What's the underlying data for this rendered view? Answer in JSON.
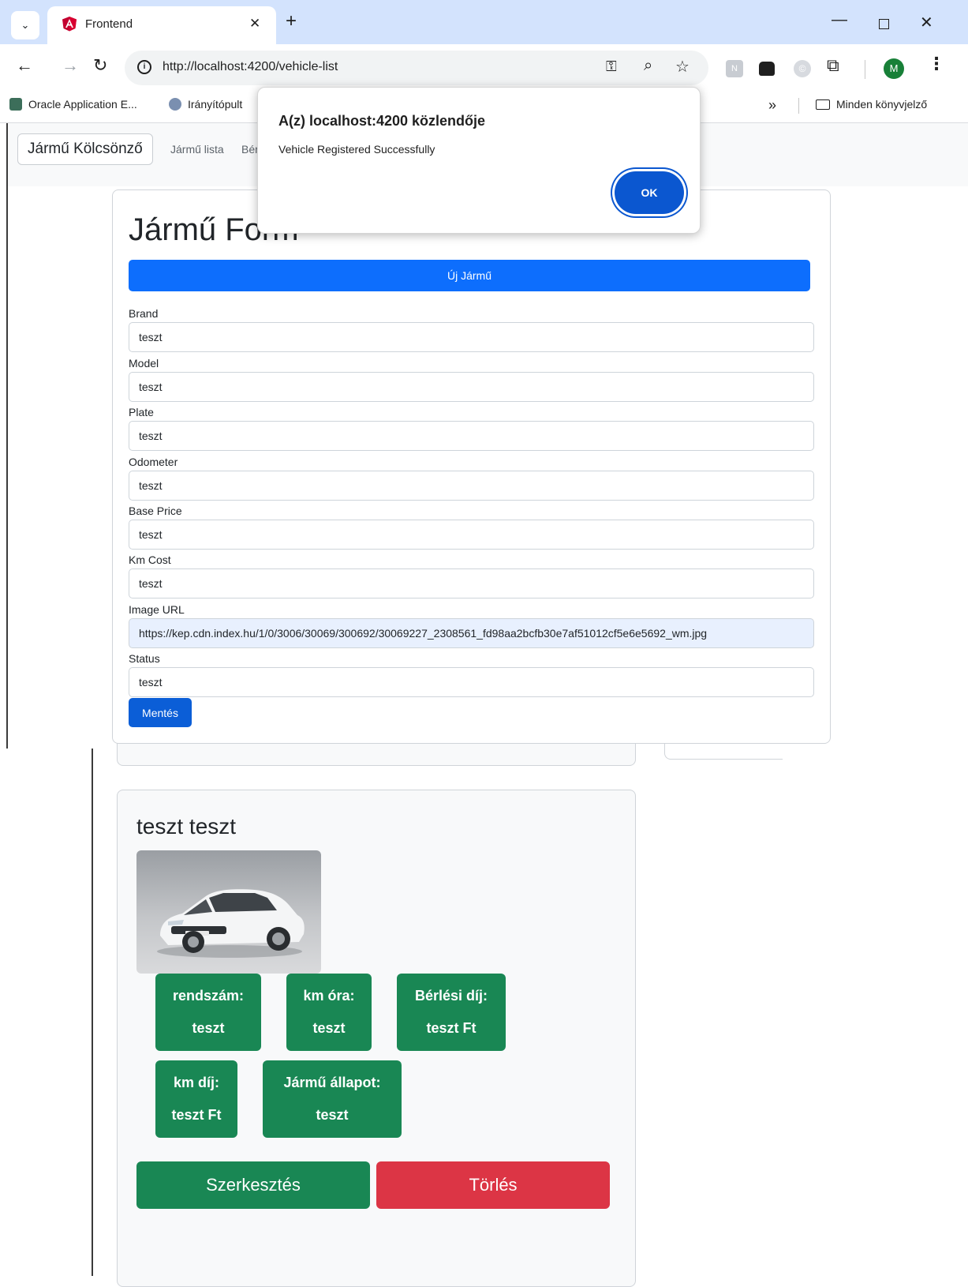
{
  "browser": {
    "tab_title": "Frontend",
    "tab_close": "✕",
    "new_tab": "+",
    "url": "http://localhost:4200/vehicle-list",
    "avatar_letter": "M",
    "bookmarks": [
      {
        "label": "Oracle Application E...",
        "color": "#3c6e5a"
      },
      {
        "label": "Irányítópult",
        "color": "#7a8fb0"
      }
    ],
    "bookmarks_overflow": "»",
    "all_bookmarks_label": "Minden könyvjelző"
  },
  "navbar": {
    "brand": "Jármű Kölcsönző",
    "links": [
      "Jármű lista",
      "Bér"
    ]
  },
  "form": {
    "title": "Jármű Form",
    "new_button": "Új Jármű",
    "fields": [
      {
        "label": "Brand",
        "value": "teszt"
      },
      {
        "label": "Model",
        "value": "teszt"
      },
      {
        "label": "Plate",
        "value": "teszt"
      },
      {
        "label": "Odometer",
        "value": "teszt"
      },
      {
        "label": "Base Price",
        "value": "teszt"
      },
      {
        "label": "Km Cost",
        "value": "teszt"
      },
      {
        "label": "Image URL",
        "value": "https://kep.cdn.index.hu/1/0/3006/30069/300692/30069227_2308561_fd98aa2bcfb30e7af51012cf5e6e5692_wm.jpg"
      },
      {
        "label": "Status",
        "value": "teszt"
      }
    ],
    "save_button": "Mentés"
  },
  "vehicle_card": {
    "title": "teszt teszt",
    "image_alt": "white hatchback car",
    "badges": [
      {
        "label": "rendszám:",
        "value": "teszt"
      },
      {
        "label": "km óra:",
        "value": "teszt"
      },
      {
        "label": "Bérlési díj:",
        "value": "teszt Ft"
      },
      {
        "label": "km díj:",
        "value": "teszt Ft"
      },
      {
        "label": "Jármű állapot:",
        "value": "teszt"
      }
    ],
    "edit_button": "Szerkesztés",
    "delete_button": "Törlés"
  },
  "dialog": {
    "title": "A(z) localhost:4200 közlendője",
    "message": "Vehicle Registered Successfully",
    "ok_button": "OK"
  },
  "colors": {
    "primary": "#0d6efd",
    "success": "#198754",
    "danger": "#dc3545",
    "dialog_button": "#0b57d0"
  }
}
